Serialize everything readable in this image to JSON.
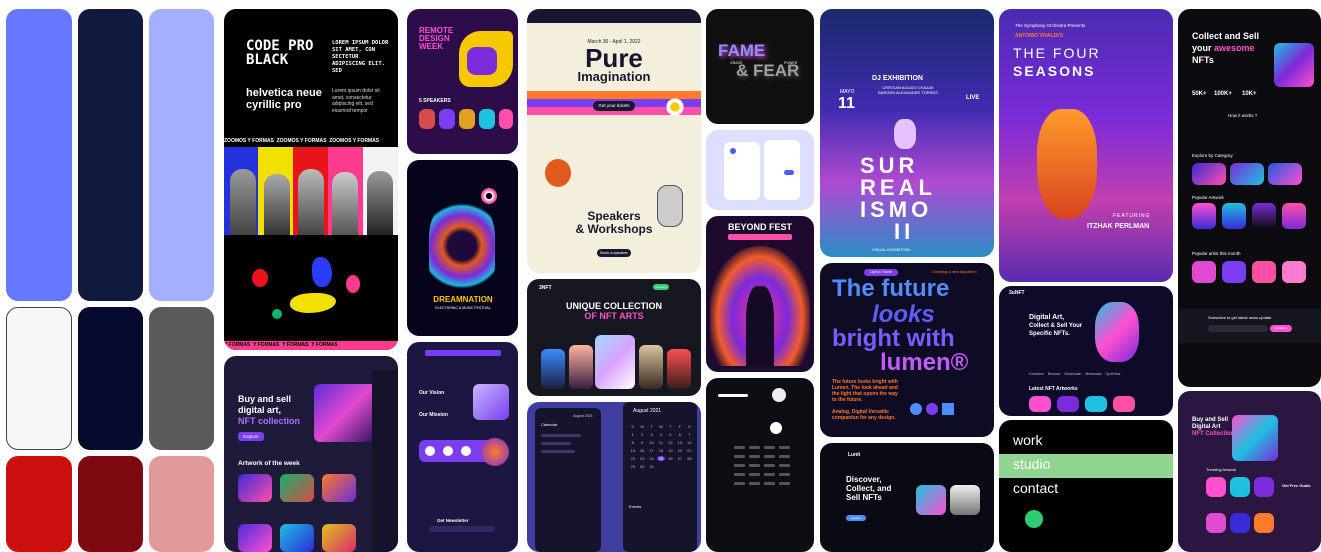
{
  "palette": {
    "colors": [
      "#6678ff",
      "#101a3f",
      "#a4b0ff",
      "#f7f7f7",
      "#050a2e",
      "#5a5a5a",
      "#cc1010",
      "#7d0a10",
      "#e09a9a"
    ]
  },
  "code_pro": {
    "title": "CODE PRO BLACK",
    "lorem": "LOREM IPSUM DOLOR SIT AMET, CON SECTETUR ADIPISCING ELIT. SED",
    "font2": "helvetica neue cyrillic pro",
    "lorem2": "Lorem ipsum dolor sit amet, consectetur adipiscing elit. sed eiusmod tempor",
    "marquee": "ZOOMOS Y FORMAS",
    "marquee2": "Y FORMAS"
  },
  "remote_design": {
    "title": "REMOTE DESIGN WEEK",
    "speakers": "5 SPEAKERS"
  },
  "dreamnation": {
    "title": "DREAMNATION",
    "sub": "ELECTRONIC & MUSIC FESTIVAL"
  },
  "pure": {
    "date": "March 30 - April 1, 2022",
    "title1": "Pure",
    "title2": "Imagination",
    "ticket": "Get your tickets",
    "speakers": "Speakers",
    "workshops": "& Workshops",
    "register": "Book a speaker"
  },
  "fame": {
    "title1": "FAME",
    "title2": "& FEAR",
    "sub1": "GRACE",
    "sub2": "POWER"
  },
  "beyond": {
    "title": "BEYOND FEST"
  },
  "surreal": {
    "heading": "DJ EXHIBITION",
    "names": "CRISTIAN AGUDO CHAZAE BARGEN ALEXANDER TORRES",
    "month": "MAYO",
    "day": "11",
    "live": "LIVE",
    "t1": "SUR",
    "t2": "REAL",
    "t3": "ISMO",
    "t4": "II",
    "foot": "VISUAL EXHIBITION"
  },
  "lumen": {
    "tag1": "Light & Future",
    "tag2": "Creating a new Algorithm",
    "h1": "The future",
    "h2": "looks",
    "h3": "bright with",
    "h4": "lumen®",
    "body": "The future looks bright with Lumen. The look ahead and the light that opens the way to the future.",
    "analog": "Analog, Digital Versatile companion for any design."
  },
  "seasons": {
    "top": "The Symphony Orchestra Presents",
    "composer": "ANTONIO VIVALDI'S",
    "t1": "THE FOUR",
    "t2": "SEASONS",
    "feat": "FEATURING",
    "artist": "ITZHAK PERLMAN"
  },
  "nft_unique": {
    "logo": "3NFT",
    "t1": "UNIQUE COLLECTION",
    "t2": "OF NFT ARTS",
    "btn": "Connect"
  },
  "buysell": {
    "t1": "Buy and sell",
    "t2": "digital art,",
    "t3": "NFT collection",
    "btn": "Explore",
    "week": "Artwork of the week"
  },
  "vision": {
    "t1": "Our Vision",
    "t2": "Our Mission",
    "news": "Get Newsletter"
  },
  "calendar": {
    "month1": "August 2021",
    "month2": "August 2021",
    "days": [
      "S",
      "M",
      "T",
      "W",
      "T",
      "F",
      "S"
    ],
    "nums": [
      "1",
      "2",
      "3",
      "4",
      "5",
      "6",
      "7",
      "8",
      "9",
      "10",
      "11",
      "12",
      "13",
      "14",
      "15",
      "16",
      "17",
      "18",
      "19",
      "20",
      "21",
      "22",
      "23",
      "24",
      "25",
      "26",
      "27",
      "28",
      "29",
      "30",
      "31"
    ],
    "label": "Calendar",
    "events": "Events"
  },
  "discover": {
    "logo": "Lunit",
    "t1": "Discover,",
    "t2": "Collect, and",
    "t3": "Sell NFTs",
    "btn": "Explore"
  },
  "specific": {
    "logo": "3uNFT",
    "t1": "Digital Art,",
    "t2": "Collect & Sell Your",
    "t3": "Specific NFTs.",
    "latest": "Latest NFT Artworks",
    "brands": [
      "Coinbase",
      "Binance",
      "Blockchain",
      "Metamask",
      "OpenSea"
    ]
  },
  "work_studio": {
    "w1": "work",
    "w2": "studio",
    "w3": "contact"
  },
  "collect_sell": {
    "t1": "Collect and Sell",
    "t2": "your",
    "t3": "awesome",
    "t4": "NFTs",
    "s1": "50K+",
    "s2": "100K+",
    "s3": "10K+",
    "how": "How it works ?",
    "cat": "Explore by Category",
    "pop": "Popular Artwork",
    "artists": "Popular artist this month",
    "sub": "Subscribe to get latest news update",
    "btn": "Subscribe"
  },
  "nft_dark": {
    "t1": "Buy and Sell",
    "t2": "Digital Art",
    "t3": "NFT Collection",
    "trend": "Trending Artwork",
    "free": "Get Free Guide"
  }
}
